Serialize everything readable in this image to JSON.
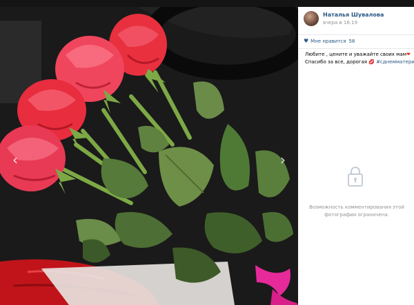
{
  "post": {
    "author_name": "Наталья Шувалова",
    "time": "вчера в 16:19",
    "likes_label": "Мне нравится",
    "likes_count": "58",
    "caption_line1": "Любите , цените и уважайте своих мам",
    "caption_line2": "Спасибо за все, дорогая",
    "hashtag": "#сднемматери"
  },
  "comments": {
    "locked_message": "Возможность комментирования этой фотографии ограничена."
  },
  "nav": {
    "prev_glyph": "‹",
    "next_glyph": "›"
  },
  "icons": {
    "heart_small": "heart-icon",
    "lock": "lock-icon",
    "emoji_heart": "red-heart-emoji",
    "emoji_kiss": "kiss-emoji"
  },
  "colors": {
    "link": "#2a5885",
    "muted": "#939393",
    "emoji_red": "#e0301e"
  }
}
